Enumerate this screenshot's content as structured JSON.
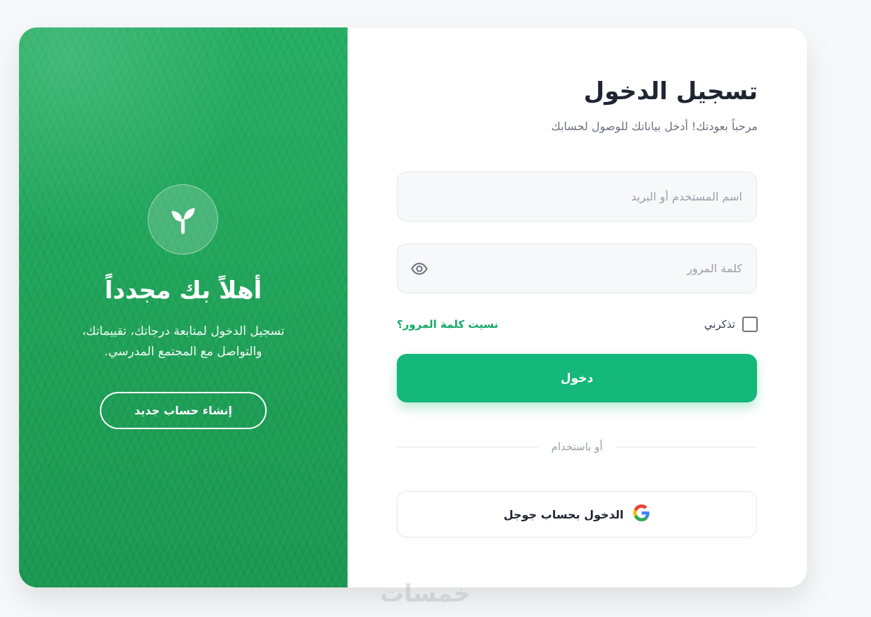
{
  "hero": {
    "title": "أهلاً بك مجدداً",
    "subtitle": "تسجيل الدخول لمتابعة درجاتك، تقييماتك، والتواصل مع المجتمع المدرسي.",
    "register_label": "إنشاء حساب جديد",
    "logo_icon": "sprout-icon"
  },
  "form": {
    "title": "تسجيل الدخول",
    "subtitle": "مرحباً بعودتك! أدخل بياناتك للوصول لحسابك",
    "username": {
      "value": "",
      "placeholder": "اسم المستخدم أو البريد"
    },
    "password": {
      "value": "",
      "placeholder": "كلمة المرور",
      "toggle_icon": "eye-icon"
    },
    "remember_label": "تذكرني",
    "remember_checked": false,
    "forgot_label": "نسيت كلمة المرور؟",
    "submit_label": "دخول",
    "divider_text": "أو باستخدام",
    "google_label": "الدخول بحساب جوجل",
    "google_icon": "google-icon"
  },
  "watermark": "خمسات",
  "colors": {
    "accent": "#14b87a",
    "link": "#14a866",
    "hero_green": "#21a65c"
  }
}
